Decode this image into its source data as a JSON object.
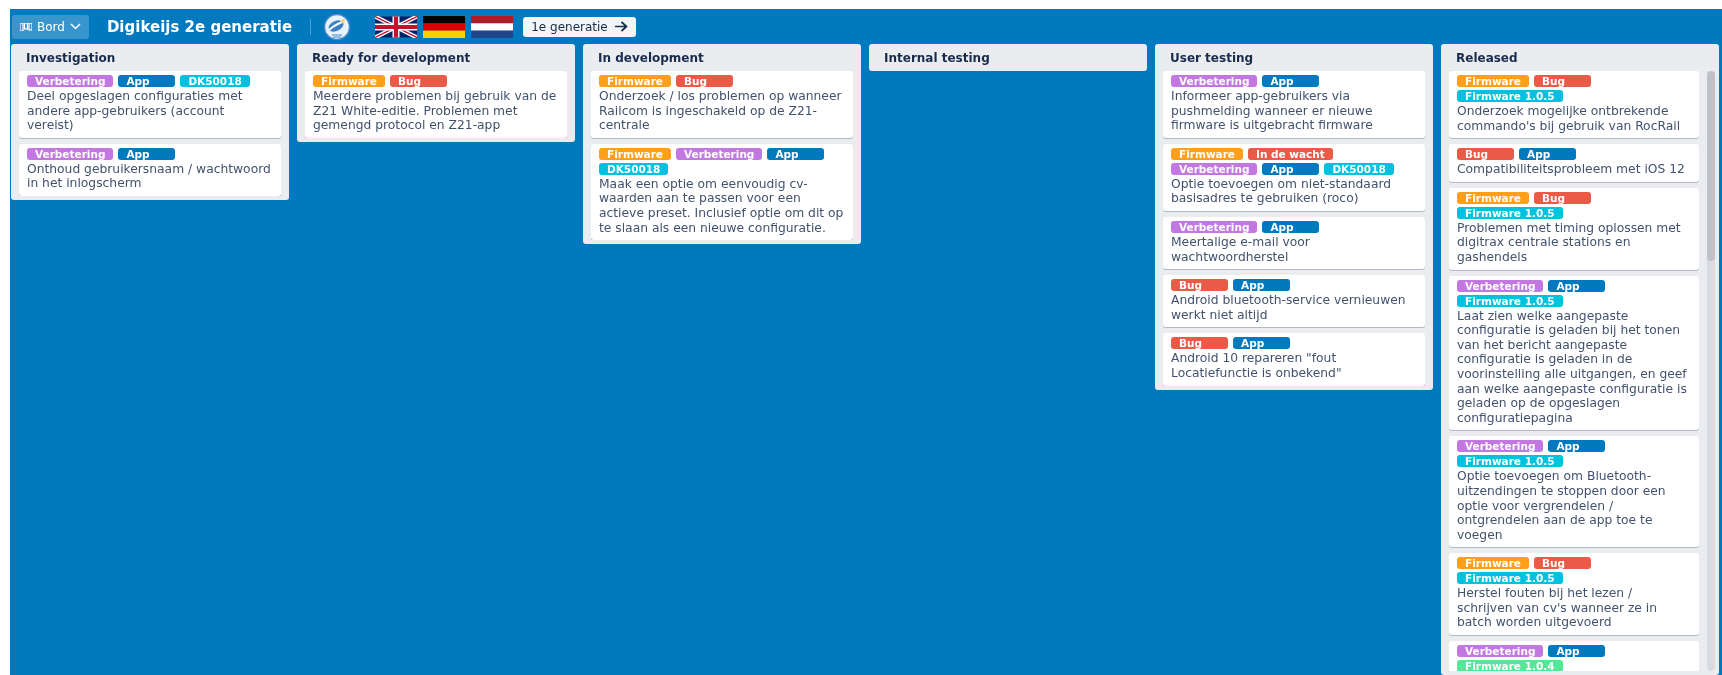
{
  "board_button": {
    "label": "Bord"
  },
  "board_title": "Digikeijs 2e generatie",
  "generation_button": {
    "label": "1e generatie"
  },
  "columns": [
    {
      "title": "Investigation",
      "cards": [
        {
          "labels": [
            {
              "text": "Verbetering",
              "color": "#c377e0"
            },
            {
              "text": "App",
              "color": "#0079bf"
            },
            {
              "text": "DK50018",
              "color": "#00c2e0"
            }
          ],
          "text": "Deel opgeslagen configuraties met andere app-gebruikers (account vereist)"
        },
        {
          "labels": [
            {
              "text": "Verbetering",
              "color": "#c377e0"
            },
            {
              "text": "App",
              "color": "#0079bf"
            }
          ],
          "text": "Onthoud gebruikersnaam / wachtwoord in het inlogscherm"
        }
      ]
    },
    {
      "title": "Ready for development",
      "cards": [
        {
          "labels": [
            {
              "text": "Firmware",
              "color": "#ff9f1a"
            },
            {
              "text": "Bug",
              "color": "#eb5a46"
            }
          ],
          "text": "Meerdere problemen bij gebruik van de Z21 White-editie. Problemen met gemengd protocol en Z21-app"
        }
      ]
    },
    {
      "title": "In development",
      "cards": [
        {
          "labels": [
            {
              "text": "Firmware",
              "color": "#ff9f1a"
            },
            {
              "text": "Bug",
              "color": "#eb5a46"
            }
          ],
          "text": "Onderzoek / los problemen op wanneer Railcom is ingeschakeld op de Z21-centrale"
        },
        {
          "labels": [
            {
              "text": "Firmware",
              "color": "#ff9f1a"
            },
            {
              "text": "Verbetering",
              "color": "#c377e0"
            },
            {
              "text": "App",
              "color": "#0079bf"
            },
            {
              "text": "DK50018",
              "color": "#00c2e0"
            }
          ],
          "text": "Maak een optie om eenvoudig cv-waarden aan te passen voor een actieve preset. Inclusief optie om dit op te slaan als een nieuwe configuratie."
        }
      ]
    },
    {
      "title": "Internal testing"
    },
    {
      "title": "User testing",
      "cards": [
        {
          "labels": [
            {
              "text": "Verbetering",
              "color": "#c377e0"
            },
            {
              "text": "App",
              "color": "#0079bf"
            }
          ],
          "text": "Informeer app-gebruikers via pushmelding wanneer er nieuwe firmware is uitgebracht firmware"
        },
        {
          "labels": [
            {
              "text": "Firmware",
              "color": "#ff9f1a"
            },
            {
              "text": "In de wacht",
              "color": "#eb5a46"
            },
            {
              "text": "Verbetering",
              "color": "#c377e0"
            },
            {
              "text": "App",
              "color": "#0079bf"
            },
            {
              "text": "DK50018",
              "color": "#00c2e0"
            }
          ],
          "text": "Optie toevoegen om niet-standaard basisadres te gebruiken (roco)"
        },
        {
          "labels": [
            {
              "text": "Verbetering",
              "color": "#c377e0"
            },
            {
              "text": "App",
              "color": "#0079bf"
            }
          ],
          "text": "Meertalige e-mail voor wachtwoordherstel"
        },
        {
          "labels": [
            {
              "text": "Bug",
              "color": "#eb5a46"
            },
            {
              "text": "App",
              "color": "#0079bf"
            }
          ],
          "text": "Android bluetooth-service vernieuwen werkt niet altijd"
        },
        {
          "labels": [
            {
              "text": "Bug",
              "color": "#eb5a46"
            },
            {
              "text": "App",
              "color": "#0079bf"
            }
          ],
          "text": "Android 10 repareren \"fout Locatiefunctie is onbekend\""
        }
      ]
    },
    {
      "title": "Released",
      "cards": [
        {
          "labels": [
            {
              "text": "Firmware",
              "color": "#ff9f1a"
            },
            {
              "text": "Bug",
              "color": "#eb5a46"
            },
            {
              "text": "Firmware 1.0.5",
              "color": "#00c2e0"
            }
          ],
          "text": "Onderzoek mogelijke ontbrekende commando's bij gebruik van RocRail"
        },
        {
          "labels": [
            {
              "text": "Bug",
              "color": "#eb5a46"
            },
            {
              "text": "App",
              "color": "#0079bf"
            }
          ],
          "text": "Compatibiliteitsprobleem met iOS 12"
        },
        {
          "labels": [
            {
              "text": "Firmware",
              "color": "#ff9f1a"
            },
            {
              "text": "Bug",
              "color": "#eb5a46"
            },
            {
              "text": "Firmware 1.0.5",
              "color": "#00c2e0"
            }
          ],
          "text": "Problemen met timing oplossen met digitrax centrale stations en gashendels"
        },
        {
          "labels": [
            {
              "text": "Verbetering",
              "color": "#c377e0"
            },
            {
              "text": "App",
              "color": "#0079bf"
            },
            {
              "text": "Firmware 1.0.5",
              "color": "#00c2e0"
            }
          ],
          "text": "Laat zien welke aangepaste configuratie is geladen bij het tonen van het bericht aangepaste configuratie is geladen in de voorinstelling alle uitgangen, en geef aan welke aangepaste configuratie is geladen op de opgeslagen configuratiepagina"
        },
        {
          "labels": [
            {
              "text": "Verbetering",
              "color": "#c377e0"
            },
            {
              "text": "App",
              "color": "#0079bf"
            },
            {
              "text": "Firmware 1.0.5",
              "color": "#00c2e0"
            }
          ],
          "text": "Optie toevoegen om Bluetooth-uitzendingen te stoppen door een optie voor vergrendelen / ontgrendelen aan de app toe te voegen"
        },
        {
          "labels": [
            {
              "text": "Firmware",
              "color": "#ff9f1a"
            },
            {
              "text": "Bug",
              "color": "#eb5a46"
            },
            {
              "text": "Firmware 1.0.5",
              "color": "#00c2e0"
            }
          ],
          "text": "Herstel fouten bij het lezen / schrijven van cv's wanneer ze in batch worden uitgevoerd"
        },
        {
          "labels": [
            {
              "text": "Verbetering",
              "color": "#c377e0"
            },
            {
              "text": "App",
              "color": "#0079bf"
            },
            {
              "text": "Firmware 1.0.4",
              "color": "#51e898"
            }
          ]
        }
      ]
    }
  ]
}
